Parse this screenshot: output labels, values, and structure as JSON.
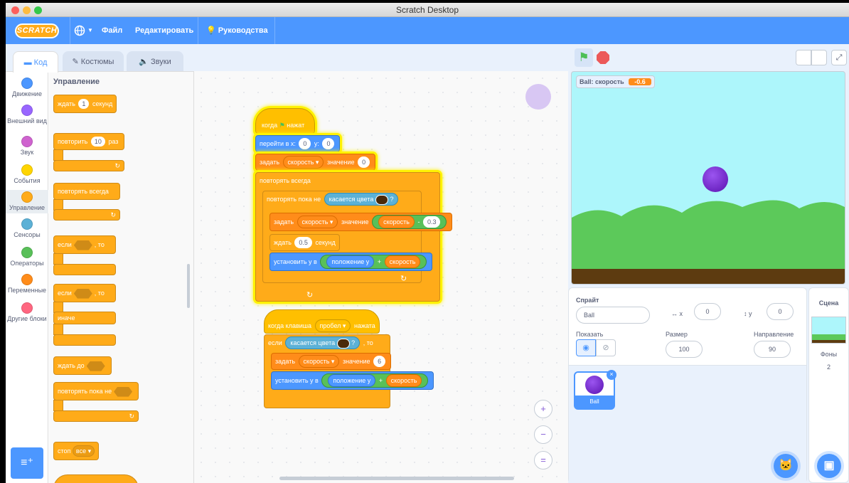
{
  "window": {
    "title": "Scratch Desktop"
  },
  "menu": {
    "logo": "SCRATCH",
    "file": "Файл",
    "edit": "Редактировать",
    "tutorials": "Руководства"
  },
  "tabs": {
    "code": "Код",
    "costumes": "Костюмы",
    "sounds": "Звуки"
  },
  "categories": [
    {
      "label": "Движение",
      "color": "#4c97ff"
    },
    {
      "label": "Внешний вид",
      "color": "#9966ff"
    },
    {
      "label": "Звук",
      "color": "#cf63cf"
    },
    {
      "label": "События",
      "color": "#ffd500"
    },
    {
      "label": "Управление",
      "color": "#ffab19"
    },
    {
      "label": "Сенсоры",
      "color": "#5cb1d6"
    },
    {
      "label": "Операторы",
      "color": "#59c059"
    },
    {
      "label": "Переменные",
      "color": "#ff8c1a"
    },
    {
      "label": "Другие блоки",
      "color": "#ff6680"
    }
  ],
  "palette": {
    "heading": "Управление",
    "wait_a": "ждать",
    "wait_val": "1",
    "wait_b": "секунд",
    "repeat_a": "повторить",
    "repeat_val": "10",
    "repeat_b": "раз",
    "forever": "повторять всегда",
    "if_a": "если",
    "if_b": ", то",
    "if2_a": "если",
    "if2_b": ", то",
    "else": "иначе",
    "wait_until": "ждать до",
    "repeat_until": "повторять пока не",
    "stop": "стоп",
    "stop_opt": "все ▾"
  },
  "script1": {
    "hat_a": "когда",
    "hat_b": "нажат",
    "goto_a": "перейти в x:",
    "goto_x": "0",
    "goto_b": "y:",
    "goto_y": "0",
    "set_a": "задать",
    "set_var": "скорость ▾",
    "set_b": "значение",
    "set_val": "0",
    "forever": "повторять всегда",
    "until_a": "повторять пока не",
    "touch": "касается цвета",
    "q": "?",
    "set2_a": "задать",
    "set2_var": "скорость ▾",
    "set2_b": "значение",
    "set2_var2": "скорость",
    "minus": "-",
    "set2_num": "0.3",
    "wait_a": "ждать",
    "wait_val": "0.5",
    "wait_b": "секунд",
    "sety_a": "установить у в",
    "sety_pos": "положение у",
    "plus": "+",
    "sety_var": "скорость"
  },
  "script2": {
    "hat_a": "когда клавиша",
    "hat_key": "пробел ▾",
    "hat_b": "нажата",
    "if_a": "если",
    "touch": "касается цвета",
    "q": "?",
    "if_b": ", то",
    "set_a": "задать",
    "set_var": "скорость ▾",
    "set_b": "значение",
    "set_val": "6",
    "sety_a": "установить у в",
    "sety_pos": "положение у",
    "plus": "+",
    "sety_var": "скорость"
  },
  "zoom": {
    "in": "+",
    "out": "−",
    "reset": "="
  },
  "monitor": {
    "label": "Ball: скорость",
    "value": "-0.6"
  },
  "sprite": {
    "header": "Спрайт",
    "name": "Ball",
    "x_label": "x",
    "x": "0",
    "y_label": "y",
    "y": "0",
    "show_label": "Показать",
    "size_label": "Размер",
    "size": "100",
    "dir_label": "Направление",
    "dir": "90",
    "thumb_label": "Ball"
  },
  "stage_pane": {
    "title": "Сцена",
    "backdrops_label": "Фоны",
    "backdrops": "2"
  },
  "colors": {
    "accent": "#4c97ff",
    "control": "#ffab19",
    "ball": "#7a2fd0",
    "grass": "#5cc95a",
    "ground": "#5d3b10",
    "sky": "#adf6fb"
  }
}
